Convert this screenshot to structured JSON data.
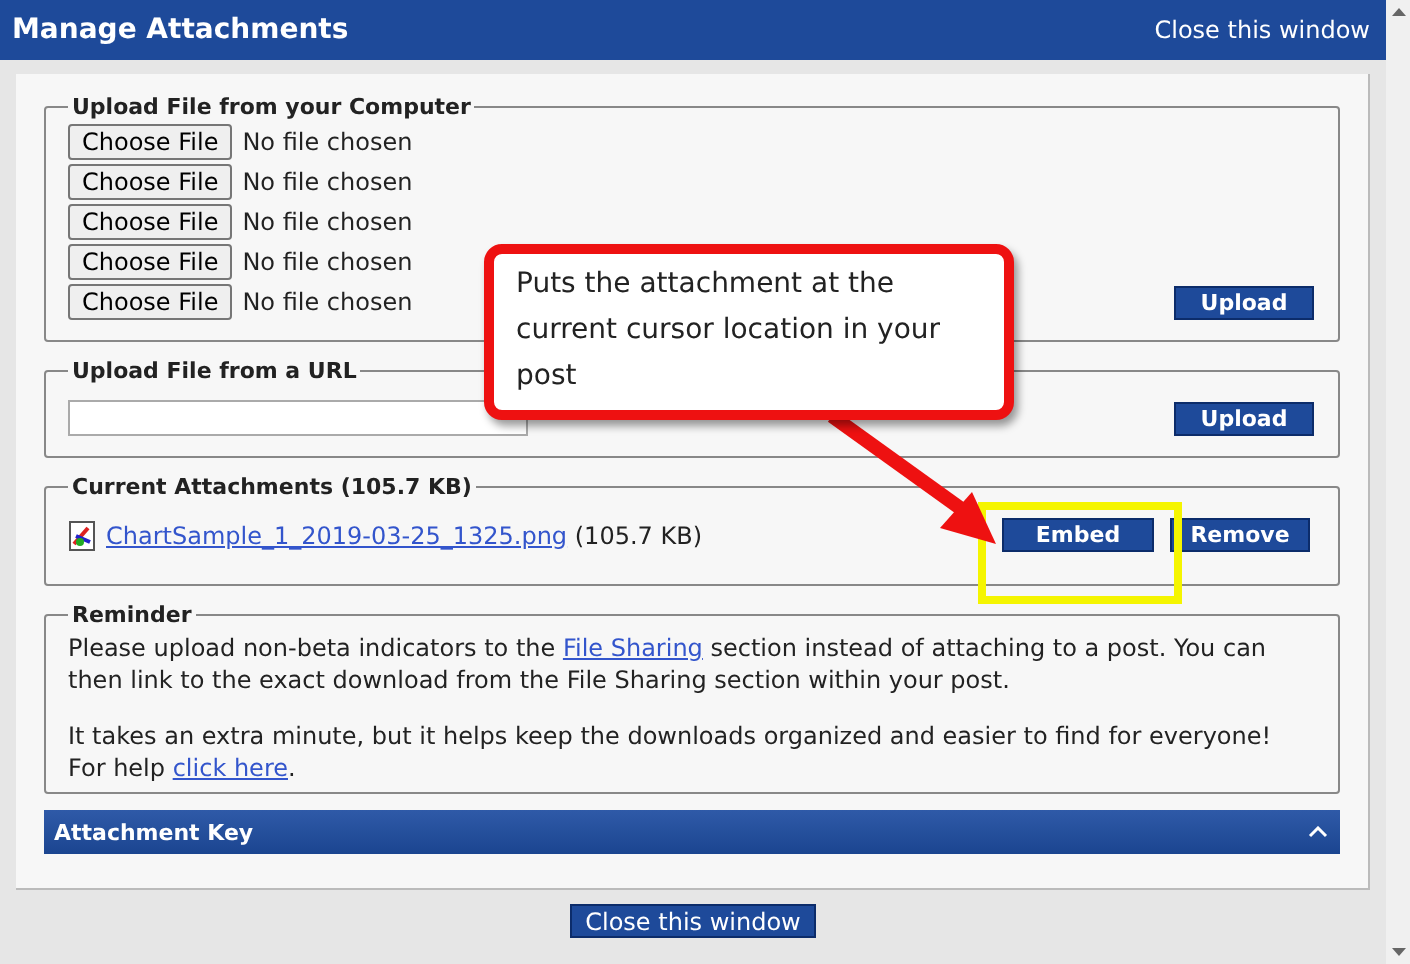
{
  "window": {
    "title": "Manage Attachments",
    "close_link": "Close this window"
  },
  "upload_computer": {
    "legend": "Upload File from your Computer",
    "files": [
      {
        "button": "Choose File",
        "status": "No file chosen"
      },
      {
        "button": "Choose File",
        "status": "No file chosen"
      },
      {
        "button": "Choose File",
        "status": "No file chosen"
      },
      {
        "button": "Choose File",
        "status": "No file chosen"
      },
      {
        "button": "Choose File",
        "status": "No file chosen"
      }
    ],
    "upload_button": "Upload"
  },
  "upload_url": {
    "legend": "Upload File from a URL",
    "upload_button": "Upload"
  },
  "current": {
    "legend": "Current Attachments (105.7 KB)",
    "attachments": [
      {
        "name": "ChartSample_1_2019-03-25_1325.png",
        "size": "(105.7 KB)",
        "embed": "Embed",
        "remove": "Remove"
      }
    ]
  },
  "reminder": {
    "legend": "Reminder",
    "paragraphs": [
      {
        "parts": [
          {
            "text": "Please upload non-beta indicators to the "
          },
          {
            "text": "File Sharing",
            "link": true
          },
          {
            "text": " section instead of attaching to a post. You can then link to the exact download from the File Sharing section within your post."
          }
        ]
      },
      {
        "parts": [
          {
            "text": "It takes an extra minute, but it helps keep the downloads organized and easier to find for everyone! For help "
          },
          {
            "text": "click here",
            "link": true
          },
          {
            "text": "."
          }
        ]
      }
    ]
  },
  "attachment_key": {
    "title": "Attachment Key",
    "expanded": true
  },
  "footer_button": "Close this window",
  "callout": {
    "text": "Puts the attachment at the current cursor location in your post"
  }
}
